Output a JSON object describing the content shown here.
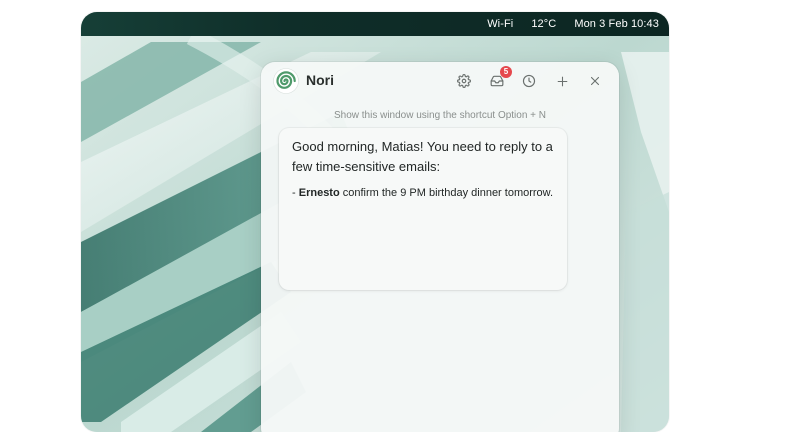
{
  "menubar": {
    "wifi": "Wi-Fi",
    "temperature": "12°C",
    "datetime": "Mon 3 Feb 10:43"
  },
  "app": {
    "title": "Nori",
    "logo_icon": "nori-spiral-logo",
    "accent_color": "#4f9a6b"
  },
  "header_buttons": {
    "settings_icon": "gear-icon",
    "mail_icon": "mail-icon",
    "mail_badge": "5",
    "badge_color": "#e5484d",
    "history_icon": "clock-icon",
    "new_icon": "plus-icon",
    "close_icon": "close-icon"
  },
  "hint_text": "Show this window using the shortcut Option + N",
  "message": {
    "greeting": "Good morning, Matias! You need to reply to a few time-sensitive emails:",
    "items": [
      {
        "prefix": "- ",
        "sender": "Ernesto",
        "text": " confirm the 9 PM birthday dinner tomorrow."
      }
    ]
  }
}
